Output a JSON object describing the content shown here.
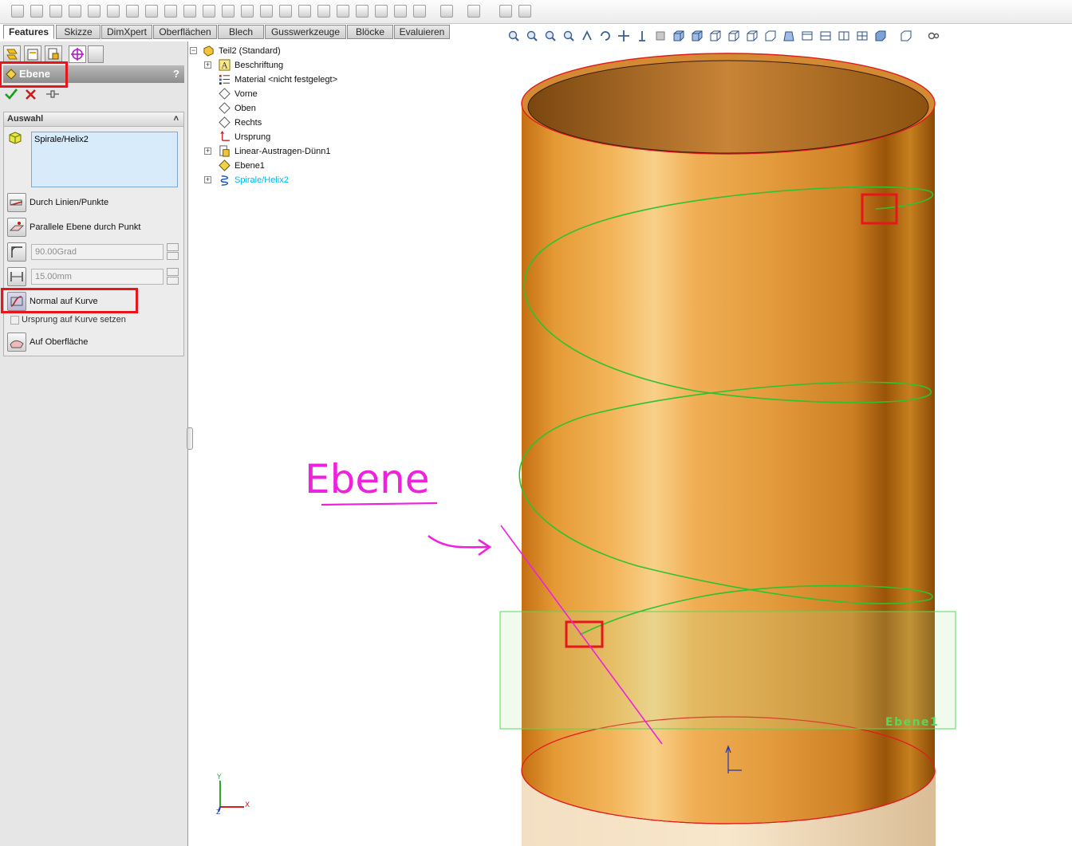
{
  "command_manager": {
    "tabs": [
      {
        "label": "Features",
        "active": true
      },
      {
        "label": "Skizze"
      },
      {
        "label": "DimXpert"
      },
      {
        "label": "Oberflächen"
      },
      {
        "label": "Blech"
      },
      {
        "label": "Gusswerkzeuge"
      },
      {
        "label": "Blöcke"
      },
      {
        "label": "Evaluieren"
      }
    ]
  },
  "property_manager": {
    "title": "Ebene",
    "help": "?",
    "selection_group": {
      "header": "Auswahl",
      "selected_item": "Spirale/Helix2"
    },
    "options": {
      "through_lines_points": "Durch Linien/Punkte",
      "parallel_plane_through_point": "Parallele Ebene durch Punkt",
      "angle_value": "90.00Grad",
      "distance_value": "15.00mm",
      "normal_to_curve": "Normal auf Kurve",
      "origin_on_curve": "Ursprung auf Kurve setzen",
      "on_surface": "Auf Oberfläche"
    }
  },
  "feature_tree": {
    "root": "Teil2  (Standard)",
    "items": [
      {
        "label": "Beschriftung",
        "icon": "annotation-icon",
        "expandable": true
      },
      {
        "label": "Material <nicht festgelegt>",
        "icon": "material-icon",
        "expandable": false
      },
      {
        "label": "Vorne",
        "icon": "plane-icon",
        "expandable": false
      },
      {
        "label": "Oben",
        "icon": "plane-icon",
        "expandable": false
      },
      {
        "label": "Rechts",
        "icon": "plane-icon",
        "expandable": false
      },
      {
        "label": "Ursprung",
        "icon": "origin-icon",
        "expandable": false
      },
      {
        "label": "Linear-Austragen-Dünn1",
        "icon": "extrude-icon",
        "expandable": true
      },
      {
        "label": "Ebene1",
        "icon": "plane-icon",
        "expandable": false
      },
      {
        "label": "Spirale/Helix2",
        "icon": "helix-icon",
        "expandable": true,
        "highlight": "#00b7ef"
      }
    ]
  },
  "viewport": {
    "annotation_text": "Ebene",
    "plane_label": "Ebene1",
    "triad": {
      "x": "X",
      "y": "Y",
      "z": "Z"
    },
    "colors": {
      "cylinder": "#e29a3c",
      "helix": "#2fc12f",
      "annotation": "#ee22dd",
      "highlight": "#e8161a",
      "plane": "#58d858"
    }
  }
}
